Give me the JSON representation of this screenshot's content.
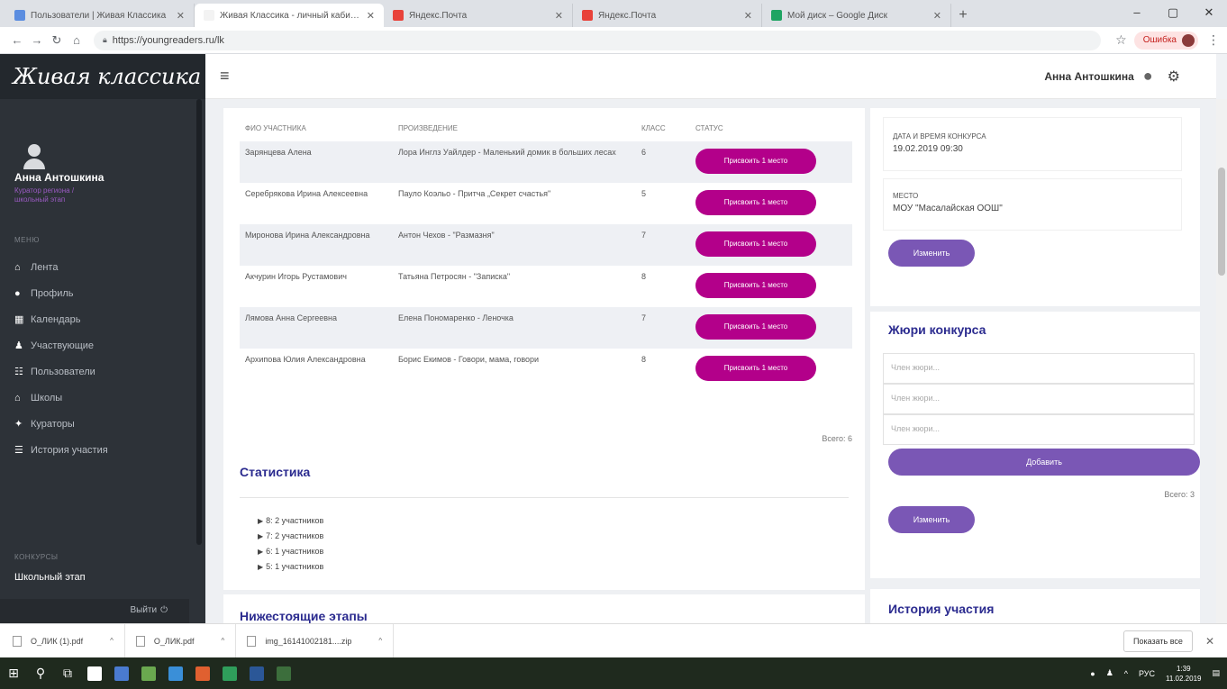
{
  "browser": {
    "tabs": [
      {
        "title": "Пользователи | Живая Классика",
        "color": "#5b8de0",
        "active": false
      },
      {
        "title": "Живая Классика - личный кабинет",
        "color": "#f3f3f3",
        "active": true
      },
      {
        "title": "Яндекс.Почта",
        "color": "#e8423a",
        "active": false
      },
      {
        "title": "Яндекс.Почта",
        "color": "#e8423a",
        "active": false
      },
      {
        "title": "Мой диск – Google Диск",
        "color": "#1fa463",
        "active": false
      }
    ],
    "url": "https://youngreaders.ru/lk",
    "profile_label": "Ошибка"
  },
  "app": {
    "brand": "Живая классика",
    "header_user": "Анна Антошкина"
  },
  "sidebar": {
    "user_name": "Анна Антошкина",
    "roles_line1": "Куратор региона /",
    "roles_line2": "школьный этап",
    "menu_section": "Меню",
    "items": [
      {
        "label": "Лента",
        "icon": "home-icon"
      },
      {
        "label": "Профиль",
        "icon": "user-icon"
      },
      {
        "label": "Календарь",
        "icon": "calendar-icon"
      },
      {
        "label": "Участвующие",
        "icon": "users-icon"
      },
      {
        "label": "Пользователи",
        "icon": "group-icon"
      },
      {
        "label": "Школы",
        "icon": "school-icon"
      },
      {
        "label": "Кураторы",
        "icon": "curators-icon"
      },
      {
        "label": "История участия",
        "icon": "list-icon"
      }
    ],
    "contests_section": "Конкурсы",
    "contest_item": "Школьный этап",
    "logout": "Выйти"
  },
  "participants": {
    "headers": [
      "ФИО участника",
      "Произведение",
      "Класс",
      "Статус"
    ],
    "award_label": "Присвоить 1 место",
    "rows": [
      {
        "name": "Зарянцева Алена",
        "work": "Лора Инглз Уайлдер - Маленький домик в больших лесах",
        "grade": "6"
      },
      {
        "name": "Серебрякова Ирина Алексеевна",
        "work": "Пауло Коэльо - Притча „Секрет счастья\"",
        "grade": "5"
      },
      {
        "name": "Миронова Ирина Александровна",
        "work": "Антон Чехов - \"Размазня\"",
        "grade": "7"
      },
      {
        "name": "Акчурин Игорь Рустамович",
        "work": "Татьяна Петросян - \"Записка\"",
        "grade": "8"
      },
      {
        "name": "Лямова Анна Сергеевна",
        "work": "Елена Пономаренко - Леночка",
        "grade": "7"
      },
      {
        "name": "Архипова Юлия Александровна",
        "work": "Борис Екимов - Говори, мама, говори",
        "grade": "8"
      }
    ],
    "total": "Всего: 6"
  },
  "statistics": {
    "title": "Статистика",
    "items": [
      "8: 2 участников",
      "7: 2 участников",
      "6: 1 участников",
      "5: 1 участников"
    ]
  },
  "lower_stages": {
    "title": "Нижестоящие этапы"
  },
  "contest_info": {
    "date_label": "Дата и время конкурса",
    "date_value": "19.02.2019 09:30",
    "place_label": "Место",
    "place_value": "МОУ \"Масалайская ООШ\"",
    "edit_label": "Изменить"
  },
  "jury": {
    "title": "Жюри конкурса",
    "placeholder": "Член жюри...",
    "add_label": "Добавить",
    "total": "Всего: 3",
    "edit_label": "Изменить"
  },
  "history": {
    "title": "История участия"
  },
  "downloads": {
    "items": [
      "О_ЛИК (1).pdf",
      "О_ЛИК.pdf",
      "img_16141002181....zip"
    ],
    "show_all": "Показать все"
  },
  "taskbar": {
    "lang": "РУС",
    "time": "1:39",
    "date": "11.02.2019"
  }
}
